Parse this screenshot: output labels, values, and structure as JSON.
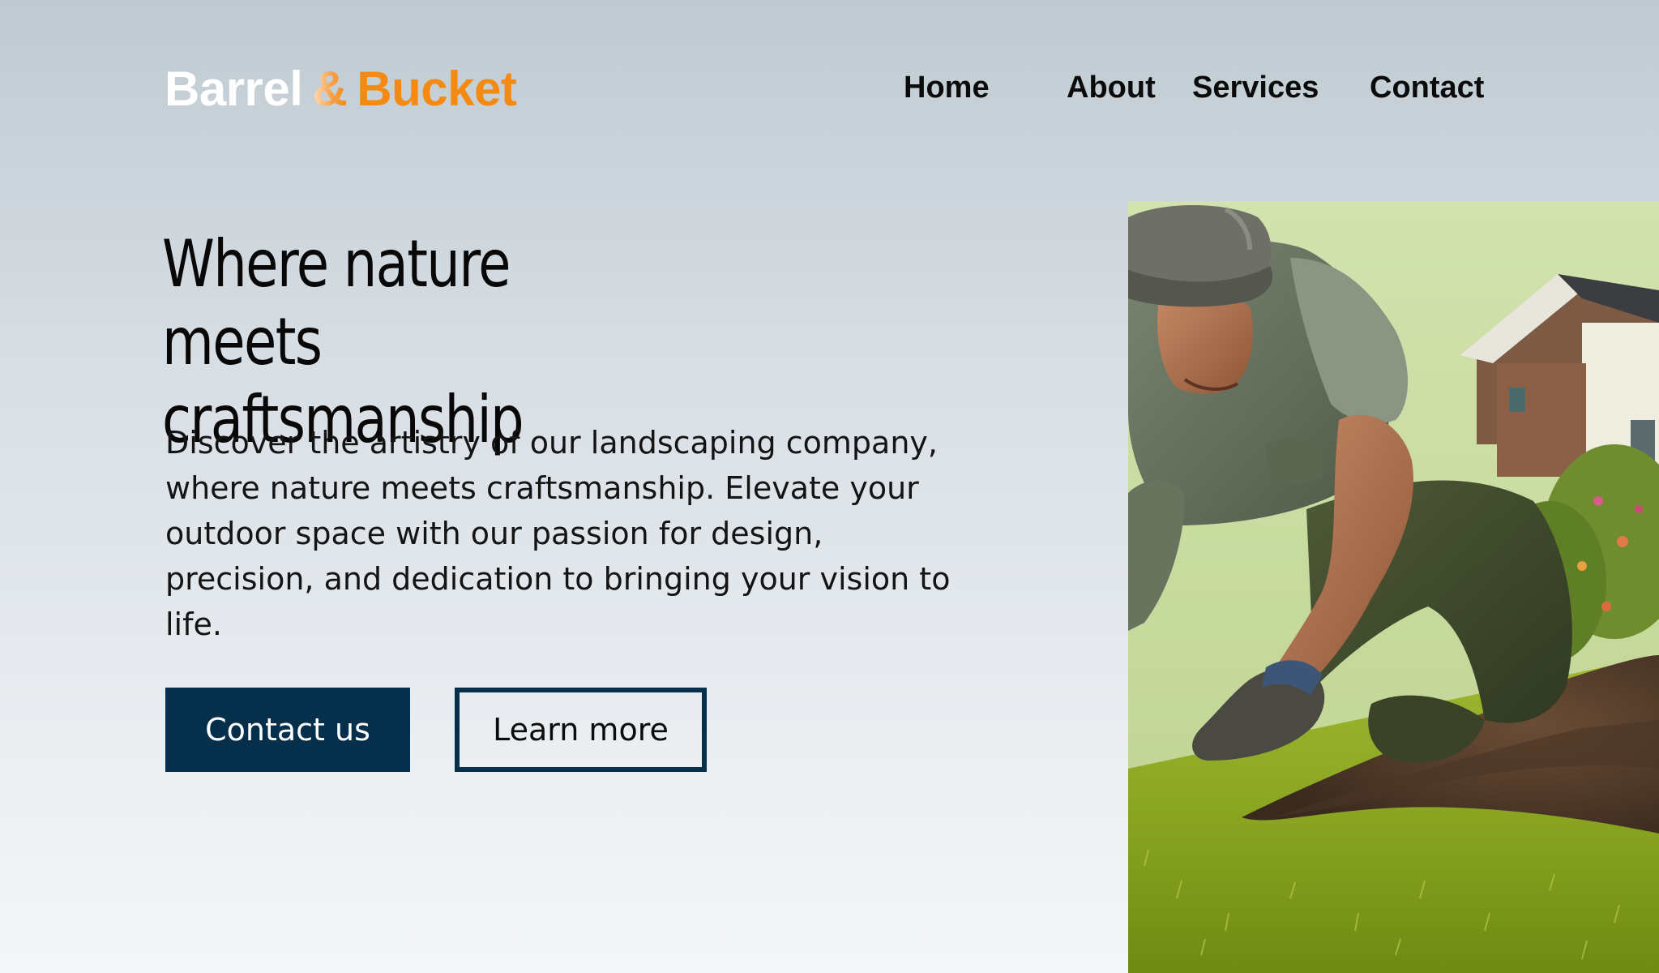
{
  "brand": {
    "name_part1": "Barrel",
    "ampersand": "&",
    "name_part2": "Bucket",
    "colors": {
      "part1": "#ffffff",
      "part2": "#f58a12"
    }
  },
  "nav": {
    "items": [
      {
        "label": "Home"
      },
      {
        "label": "About"
      },
      {
        "label": "Services"
      },
      {
        "label": "Contact"
      }
    ]
  },
  "hero": {
    "title": "Where nature meets craftsmanship",
    "description": "Discover the artistry of our landscaping company, where nature meets craftsmanship. Elevate your outdoor space with our passion for design, precision, and dedication to bringing your vision to life.",
    "primary_button": "Contact us",
    "secondary_button": "Learn more",
    "image_icon": "landscaper-laying-turf-photo"
  },
  "colors": {
    "accent": "#052f4a",
    "brand_orange": "#f58a12"
  }
}
